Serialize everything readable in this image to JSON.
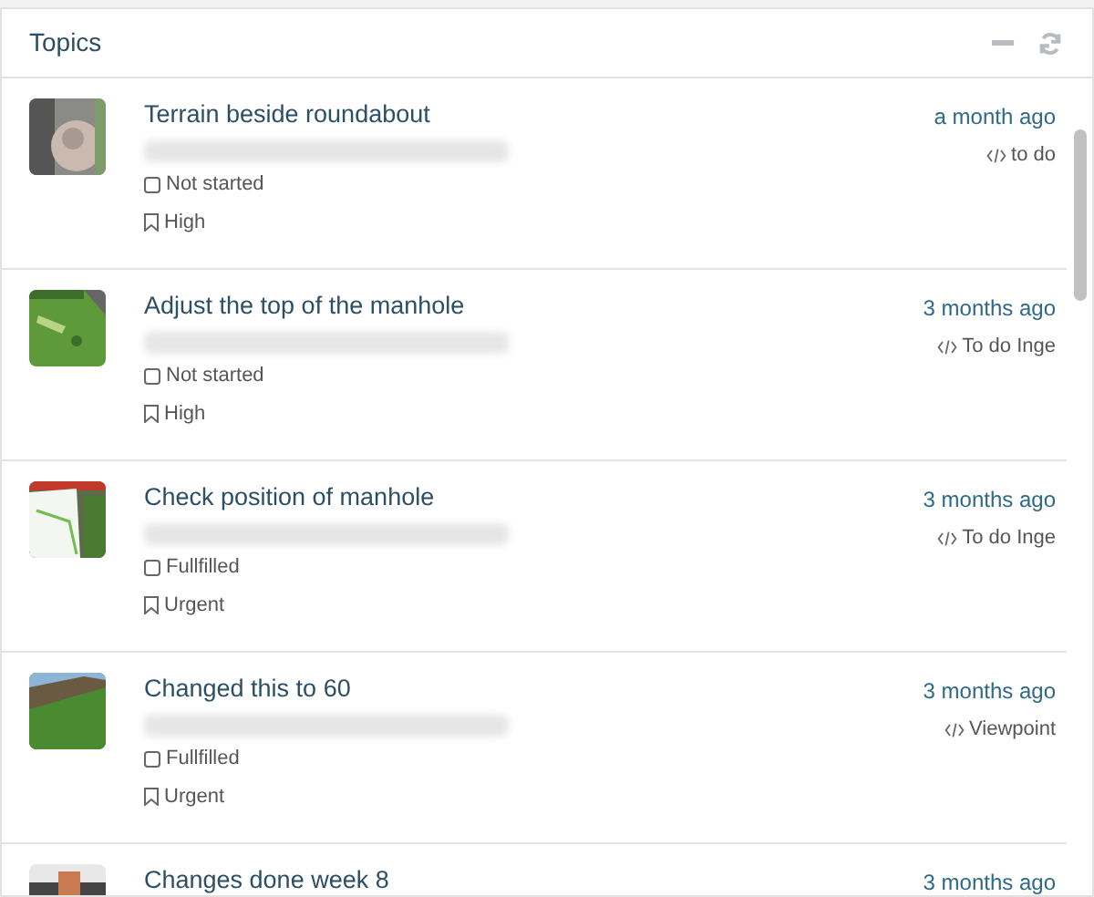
{
  "panel": {
    "title": "Topics"
  },
  "topics": [
    {
      "title": "Terrain beside roundabout",
      "status": "Not started",
      "priority": "High",
      "time": "a month ago",
      "label": "to do"
    },
    {
      "title": "Adjust the top of the manhole",
      "status": "Not started",
      "priority": "High",
      "time": "3 months ago",
      "label": "To do Inge"
    },
    {
      "title": "Check position of manhole",
      "status": "Fullfilled",
      "priority": "Urgent",
      "time": "3 months ago",
      "label": "To do Inge"
    },
    {
      "title": "Changed this to 60",
      "status": "Fullfilled",
      "priority": "Urgent",
      "time": "3 months ago",
      "label": "Viewpoint"
    },
    {
      "title": "Changes done week 8",
      "time": "3 months ago"
    }
  ]
}
